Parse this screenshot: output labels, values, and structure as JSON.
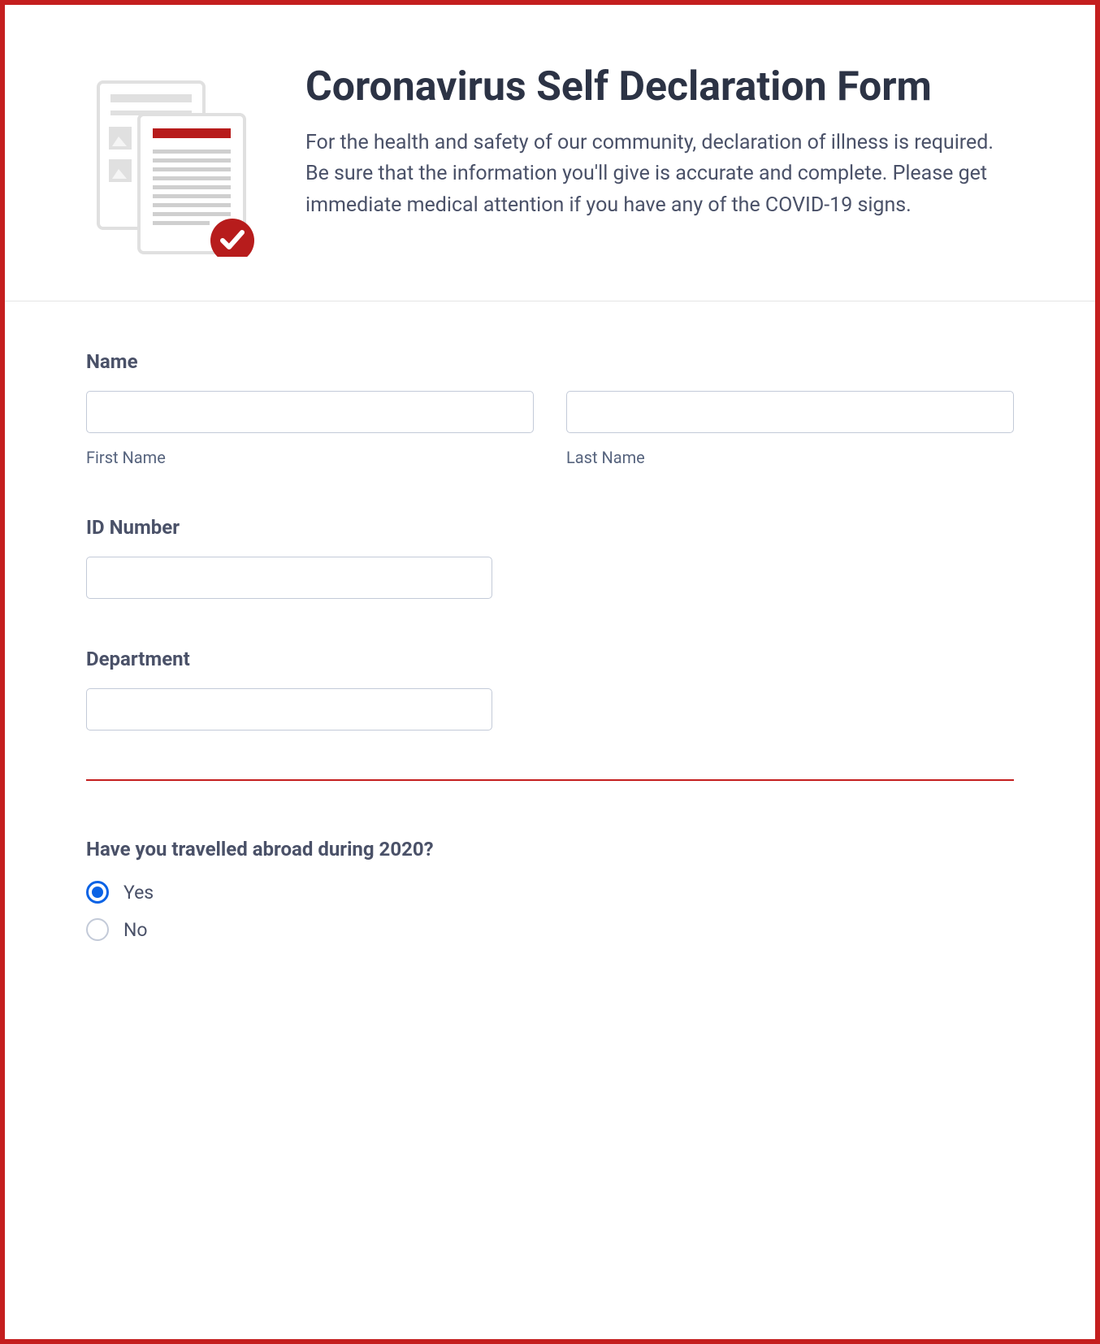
{
  "header": {
    "title": "Coronavirus Self Declaration Form",
    "description": "For the health and safety of our community, declaration of illness is required. Be sure that the information you'll give is accurate and complete. Please get immediate medical attention if you have any of the COVID-19 signs."
  },
  "fields": {
    "name": {
      "label": "Name",
      "first_sublabel": "First Name",
      "first_value": "",
      "last_sublabel": "Last Name",
      "last_value": ""
    },
    "id_number": {
      "label": "ID Number",
      "value": ""
    },
    "department": {
      "label": "Department",
      "value": ""
    }
  },
  "question": {
    "label": "Have you travelled abroad during 2020?",
    "options": [
      {
        "label": "Yes",
        "selected": true
      },
      {
        "label": "No",
        "selected": false
      }
    ]
  }
}
